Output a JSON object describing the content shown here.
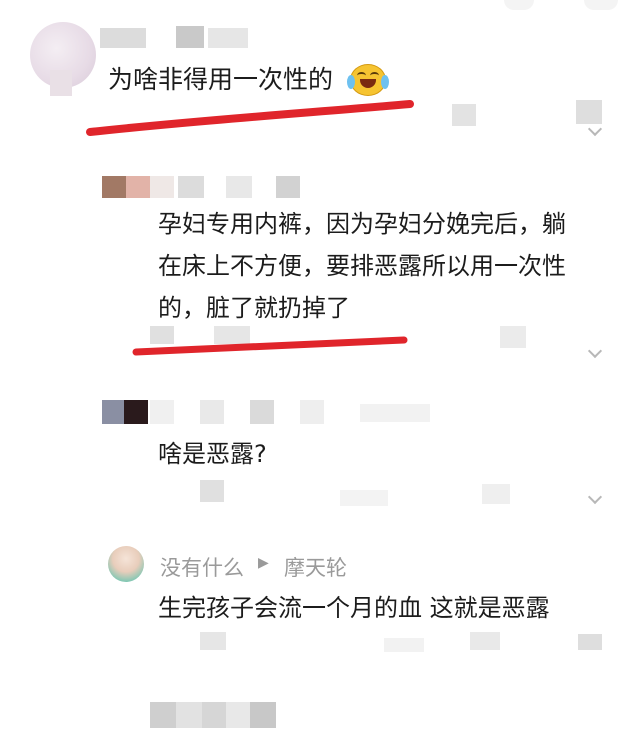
{
  "comments": [
    {
      "text": "为啥非得用一次性的",
      "emoji": "laughing-crying-emoji",
      "highlight_color": "#e0252b"
    },
    {
      "text": "孕妇专用内裤，因为孕妇分娩完后，躺在床上不方便，要排恶露所以用一次性的，脏了就扔掉了",
      "lines": [
        "孕妇专用内裤，因为孕妇分娩完后，躺",
        "在床上不方便，要排恶露所以用一次性",
        "的，脏了就扔掉了"
      ],
      "highlight_color": "#e0252b"
    },
    {
      "text": "啥是恶露?"
    },
    {
      "username": "没有什么",
      "reply_arrow": "▶",
      "reply_to": "摩天轮",
      "text": "生完孩子会流一个月的血 这就是恶露"
    }
  ],
  "colors": {
    "text": "#1c1c1c",
    "meta": "#9a9a9a",
    "highlight": "#e0252b",
    "blur": "#e3e3e3"
  }
}
